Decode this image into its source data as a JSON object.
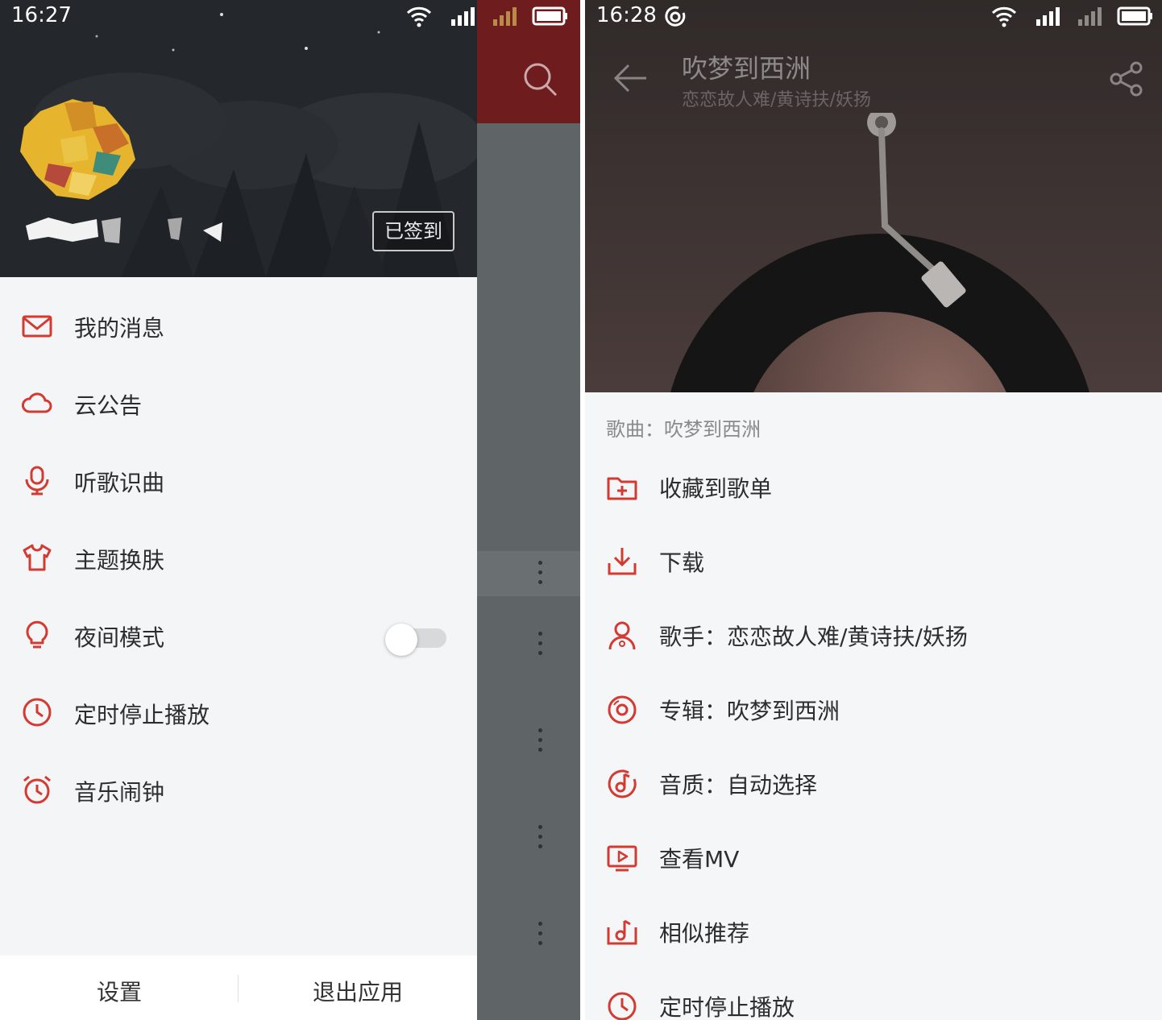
{
  "left_screen": {
    "status_bar": {
      "time": "16:27",
      "icons": [
        "wifi-icon",
        "signal-icon",
        "signal-weak-icon",
        "battery-icon"
      ]
    },
    "header": {
      "signin_label": "已签到"
    },
    "menu": [
      {
        "label": "我的消息",
        "icon": "mail-icon"
      },
      {
        "label": "云公告",
        "icon": "cloud-icon"
      },
      {
        "label": "听歌识曲",
        "icon": "microphone-icon"
      },
      {
        "label": "主题换肤",
        "icon": "tshirt-icon"
      },
      {
        "label": "夜间模式",
        "icon": "lightbulb-icon",
        "toggle": false
      },
      {
        "label": "定时停止播放",
        "icon": "clock-icon"
      },
      {
        "label": "音乐闹钟",
        "icon": "alarm-clock-icon"
      }
    ],
    "footer": {
      "settings_label": "设置",
      "exit_label": "退出应用"
    }
  },
  "right_screen": {
    "status_bar": {
      "time": "16:28",
      "icons": [
        "netease-icon",
        "wifi-icon",
        "signal-icon",
        "signal-weak-icon",
        "battery-icon"
      ]
    },
    "header": {
      "title": "吹梦到西洲",
      "artist": "恋恋故人难/黄诗扶/妖扬"
    },
    "sheet": {
      "heading": "歌曲：吹梦到西洲",
      "items": [
        {
          "label": "收藏到歌单",
          "icon": "add-folder-icon"
        },
        {
          "label": "下载",
          "icon": "download-icon"
        },
        {
          "label": "歌手：恋恋故人难/黄诗扶/妖扬",
          "icon": "singer-icon"
        },
        {
          "label": "专辑：吹梦到西洲",
          "icon": "album-icon"
        },
        {
          "label": "音质：自动选择",
          "icon": "quality-icon"
        },
        {
          "label": "查看MV",
          "icon": "mv-icon"
        },
        {
          "label": "相似推荐",
          "icon": "similar-icon"
        },
        {
          "label": "定时停止播放",
          "icon": "timer-icon"
        }
      ]
    }
  },
  "colors": {
    "accent": "#d33a31",
    "header_dark": "#24272b",
    "title_bar_red": "#6e1c1e",
    "overlay_gray": "#5f6466"
  }
}
